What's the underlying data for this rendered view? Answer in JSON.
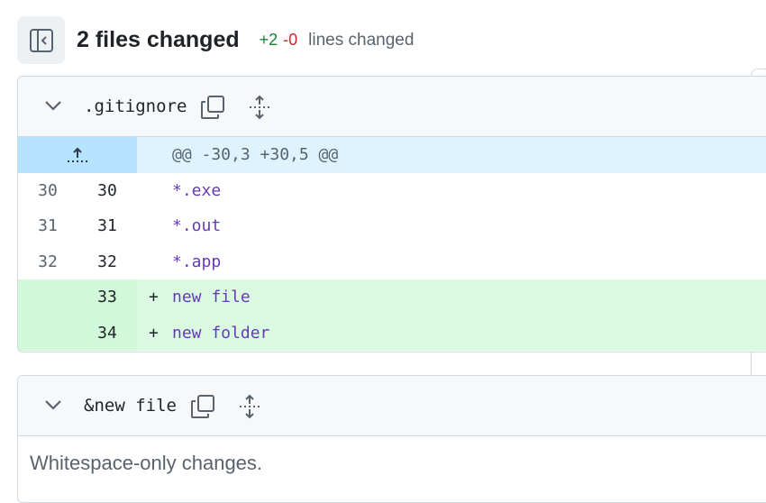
{
  "header": {
    "title": "2 files changed",
    "additions": "+2",
    "deletions": "-0",
    "lines_changed_label": "lines changed",
    "toggle_icon": "sidebar-toggle-icon"
  },
  "files": [
    {
      "name": ".gitignore",
      "hunk_header": "@@ -30,3 +30,5 @@",
      "lines": [
        {
          "old": "30",
          "new": "30",
          "sign": "",
          "text": "*.exe",
          "type": "context"
        },
        {
          "old": "31",
          "new": "31",
          "sign": "",
          "text": "*.out",
          "type": "context"
        },
        {
          "old": "32",
          "new": "32",
          "sign": "",
          "text": "*.app",
          "type": "context"
        },
        {
          "old": "",
          "new": "33",
          "sign": "+",
          "text": "new file",
          "type": "add"
        },
        {
          "old": "",
          "new": "34",
          "sign": "+",
          "text": "new folder",
          "type": "add"
        }
      ]
    },
    {
      "name": "&new file",
      "message": "Whitespace-only changes."
    }
  ],
  "colors": {
    "additions": "#1a7f37",
    "deletions": "#cf222e",
    "hunk_bg": "#ddf4ff",
    "add_bg": "#dafbe1",
    "token": "#6639ba"
  }
}
